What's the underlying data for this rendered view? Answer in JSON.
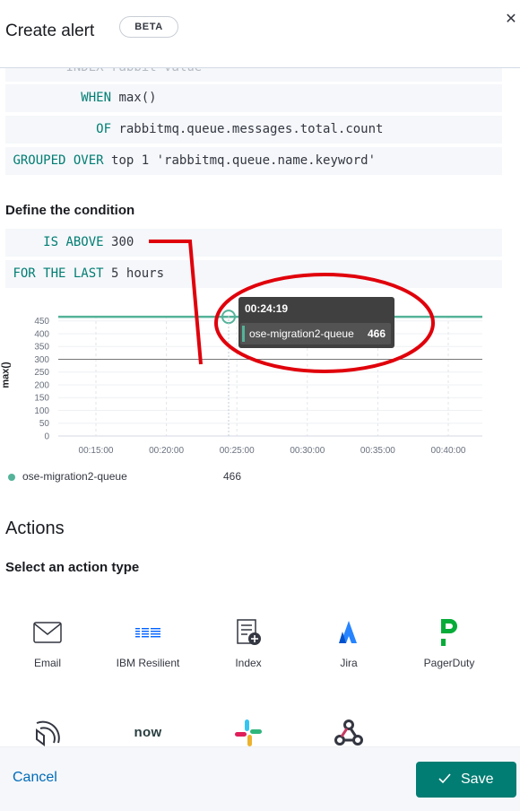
{
  "header": {
    "title": "Create alert",
    "badge": "BETA"
  },
  "expression": {
    "index_line": {
      "keyword": "INDEX",
      "value": "rabbit-value"
    },
    "when_line": {
      "keyword": "WHEN",
      "value": "max()"
    },
    "of_line": {
      "keyword": "OF",
      "value": "rabbitmq.queue.messages.total.count"
    },
    "grouped_line": {
      "keyword": "GROUPED OVER",
      "value": "top 1 'rabbitmq.queue.name.keyword'"
    }
  },
  "condition": {
    "title": "Define the condition",
    "threshold": {
      "keyword": "IS ABOVE",
      "value": "300"
    },
    "time_window": {
      "keyword": "FOR THE LAST",
      "value": "5 hours"
    }
  },
  "chart_data": {
    "type": "line",
    "ylabel": "max()",
    "ylim": [
      0,
      470
    ],
    "yticks": [
      "450",
      "400",
      "350",
      "300",
      "250",
      "200",
      "150",
      "100",
      "50",
      "0"
    ],
    "xticks": [
      "00:15:00",
      "00:20:00",
      "00:25:00",
      "00:30:00",
      "00:35:00",
      "00:40:00"
    ],
    "threshold": 300,
    "grid": true,
    "series": [
      {
        "name": "ose-migration2-queue",
        "value": 466,
        "color": "#54b399"
      }
    ],
    "tooltip": {
      "time": "00:24:19",
      "series": "ose-migration2-queue",
      "value": "466"
    }
  },
  "legend": {
    "name": "ose-migration2-queue",
    "value": "466"
  },
  "actions": {
    "title": "Actions",
    "subtitle": "Select an action type",
    "types": [
      {
        "label": "Email",
        "icon": "email-icon"
      },
      {
        "label": "IBM Resilient",
        "icon": "ibm-icon"
      },
      {
        "label": "Index",
        "icon": "index-icon"
      },
      {
        "label": "Jira",
        "icon": "jira-icon"
      },
      {
        "label": "PagerDuty",
        "icon": "pagerduty-icon"
      },
      {
        "label": "",
        "icon": "servicenow-sir-icon"
      },
      {
        "label": "now",
        "icon": "servicenow-icon"
      },
      {
        "label": "",
        "icon": "slack-icon"
      },
      {
        "label": "",
        "icon": "webhook-icon"
      }
    ]
  },
  "footer": {
    "cancel_label": "Cancel",
    "save_label": "Save"
  },
  "colors": {
    "accent": "#017d73",
    "series": "#54b399",
    "link": "#006bb8",
    "annotation": "#e0000b"
  }
}
